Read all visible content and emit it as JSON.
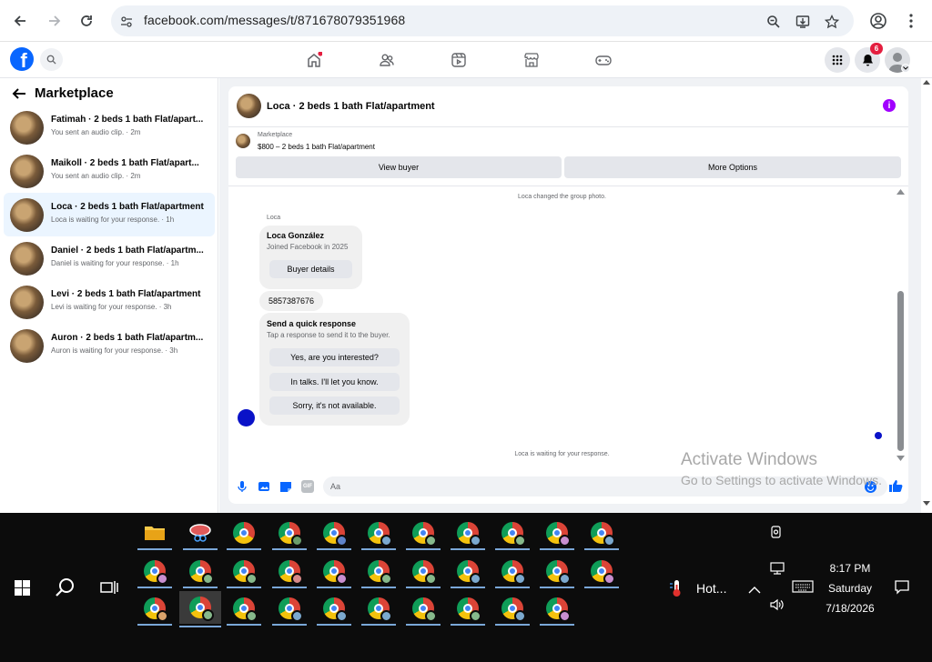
{
  "browser": {
    "url": "facebook.com/messages/t/871678079351968"
  },
  "fb": {
    "notif_count": "6"
  },
  "sidebar": {
    "title": "Marketplace",
    "conversations": [
      {
        "title": "Fatimah · 2 beds 1 bath Flat/apart...",
        "subtitle": "You sent an audio clip. · 2m"
      },
      {
        "title": "Maikoll · 2 beds 1 bath Flat/apart...",
        "subtitle": "You sent an audio clip. · 2m"
      },
      {
        "title": "Loca · 2 beds 1 bath Flat/apartment",
        "subtitle": "Loca is waiting for your response. · 1h"
      },
      {
        "title": "Daniel · 2 beds 1 bath Flat/apartm...",
        "subtitle": "Daniel is waiting for your response. · 1h"
      },
      {
        "title": "Levi · 2 beds 1 bath Flat/apartment",
        "subtitle": "Levi is waiting for your response. · 3h"
      },
      {
        "title": "Auron · 2 beds 1 bath Flat/apartm...",
        "subtitle": "Auron is waiting for your response. · 3h"
      }
    ]
  },
  "chat": {
    "title": "Loca · 2 beds 1 bath Flat/apartment",
    "marketplace_label": "Marketplace",
    "listing": "$800 – 2 beds 1 bath Flat/apartment",
    "view_buyer": "View buyer",
    "more_options": "More Options",
    "system_photo": "Loca changed the group photo.",
    "sender": "Loca",
    "profile_name": "Loca González",
    "profile_joined": "Joined Facebook in 2025",
    "buyer_details": "Buyer details",
    "phone": "5857387676",
    "quick_title": "Send a quick response",
    "quick_sub": "Tap a response to send it to the buyer.",
    "quick_1": "Yes, are you interested?",
    "quick_2": "In talks. I'll let you know.",
    "quick_3": "Sorry, it's not available.",
    "waiting": "Loca is waiting for your response.",
    "composer_placeholder": "Aa",
    "gif_label": "GIF"
  },
  "watermark": {
    "line1": "Activate Windows",
    "line2": "Go to Settings to activate Windows."
  },
  "taskbar": {
    "weather": "Hot...",
    "time": "8:17 PM",
    "day": "Saturday",
    "date": "7/18/2026"
  },
  "colors": {
    "fb_blue": "#0866ff",
    "selected_row": "#ebf5ff",
    "info_purple": "#a100ff"
  }
}
